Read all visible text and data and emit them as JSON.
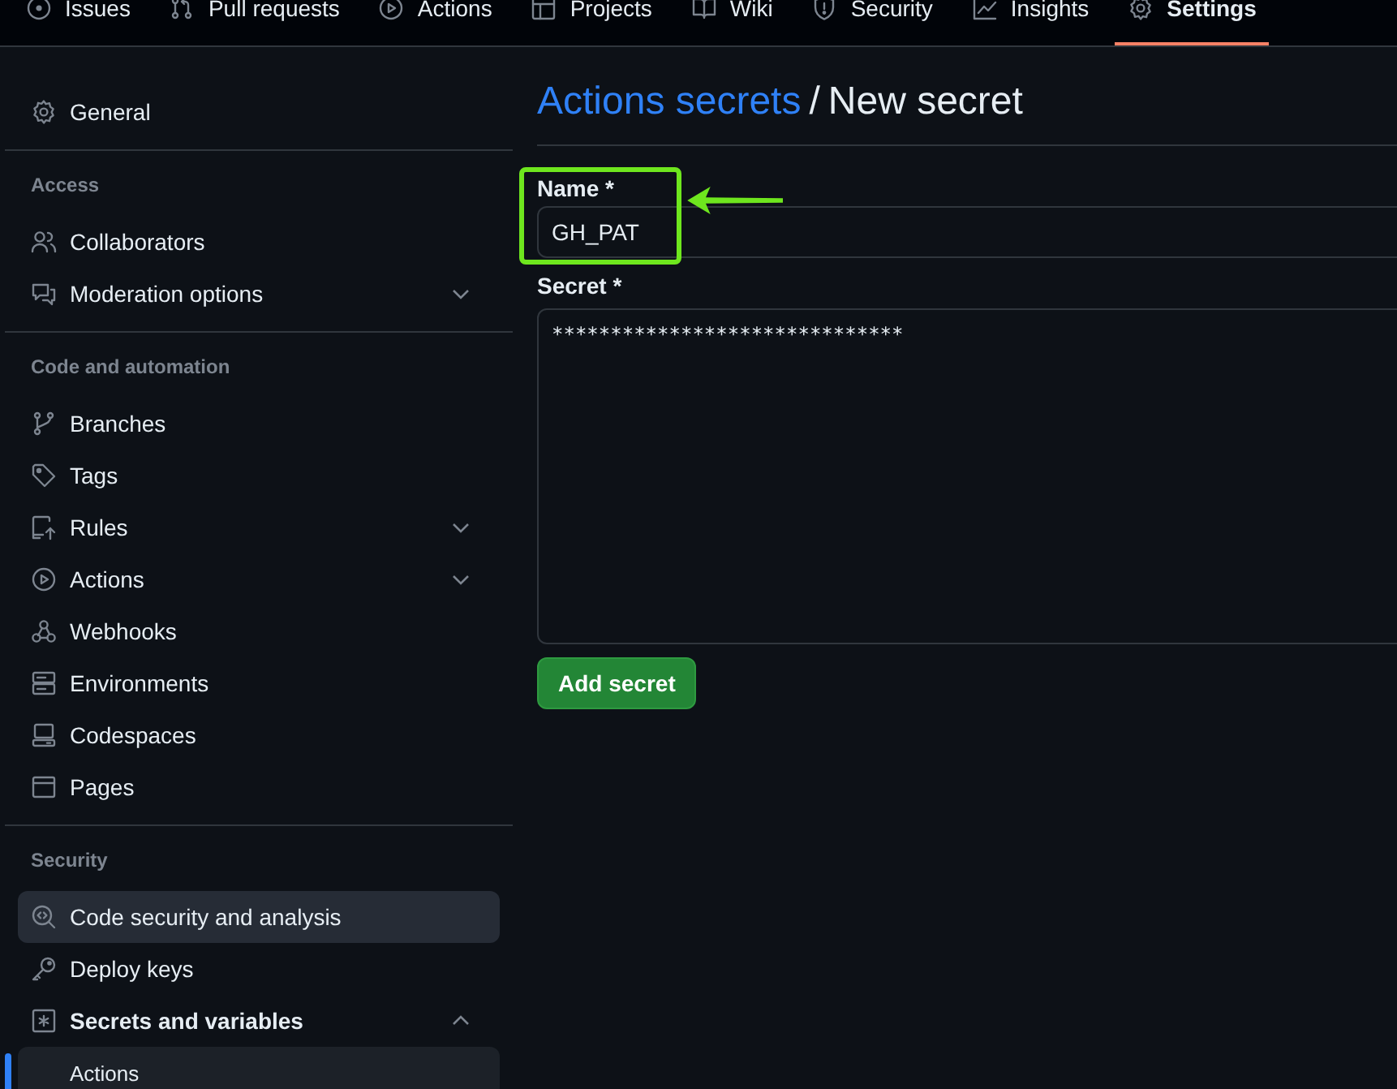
{
  "nav": {
    "tabs": [
      {
        "label": "Issues",
        "selected": false
      },
      {
        "label": "Pull requests",
        "selected": false
      },
      {
        "label": "Actions",
        "selected": false
      },
      {
        "label": "Projects",
        "selected": false
      },
      {
        "label": "Wiki",
        "selected": false
      },
      {
        "label": "Security",
        "selected": false
      },
      {
        "label": "Insights",
        "selected": false
      },
      {
        "label": "Settings",
        "selected": true
      }
    ]
  },
  "sidebar": {
    "sections": [
      {
        "items": [
          {
            "label": "General",
            "selected": false,
            "hovered": false
          }
        ]
      },
      {
        "heading": "Access",
        "items": [
          {
            "label": "Collaborators",
            "selected": false,
            "hovered": false
          },
          {
            "label": "Moderation options",
            "selected": false,
            "hovered": false,
            "expanded": false
          }
        ]
      },
      {
        "heading": "Code and automation",
        "items": [
          {
            "label": "Branches",
            "selected": false,
            "hovered": false
          },
          {
            "label": "Tags",
            "selected": false,
            "hovered": false
          },
          {
            "label": "Rules",
            "selected": false,
            "hovered": false,
            "expanded": false
          },
          {
            "label": "Actions",
            "selected": false,
            "hovered": false,
            "expanded": false
          },
          {
            "label": "Webhooks",
            "selected": false,
            "hovered": false
          },
          {
            "label": "Environments",
            "selected": false,
            "hovered": false
          },
          {
            "label": "Codespaces",
            "selected": false,
            "hovered": false
          },
          {
            "label": "Pages",
            "selected": false,
            "hovered": false
          }
        ]
      },
      {
        "heading": "Security",
        "items": [
          {
            "label": "Code security and analysis",
            "selected": false,
            "hovered": true
          },
          {
            "label": "Deploy keys",
            "selected": false,
            "hovered": false
          },
          {
            "label": "Secrets and variables",
            "selected": false,
            "hovered": false,
            "expanded": true,
            "children": [
              {
                "label": "Actions",
                "selected": true
              }
            ]
          }
        ]
      }
    ]
  },
  "page": {
    "breadcrumb_link": "Actions secrets",
    "separator": "/",
    "title": "New secret",
    "name_field": {
      "label": "Name *",
      "value": "GH_PAT"
    },
    "secret_field": {
      "label": "Secret *",
      "value": "******************************"
    },
    "submit_button": "Add secret"
  },
  "callouts": {
    "box": true,
    "arrow": true
  }
}
